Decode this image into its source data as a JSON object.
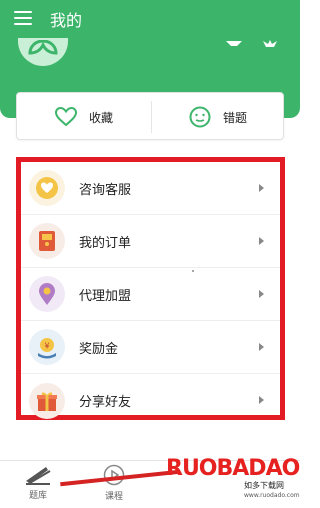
{
  "header": {
    "title": "我的"
  },
  "quick_actions": [
    {
      "label": "收藏",
      "icon": "heart-icon"
    },
    {
      "label": "错题",
      "icon": "smiley-icon"
    }
  ],
  "menu": [
    {
      "label": "咨询客服",
      "icon": "heart-chat-icon"
    },
    {
      "label": "我的订单",
      "icon": "order-envelope-icon"
    },
    {
      "label": "代理加盟",
      "icon": "location-pin-icon"
    },
    {
      "label": "奖励金",
      "icon": "money-bag-icon"
    },
    {
      "label": "分享好友",
      "icon": "gift-box-icon"
    }
  ],
  "bottom_nav": [
    {
      "label": "题库",
      "icon": "question-bank-icon"
    },
    {
      "label": "课程",
      "icon": "play-circle-icon"
    }
  ],
  "watermark": {
    "brand": "RUOBADAO",
    "slogan": "如多下载网",
    "url": "www.ruodado.com"
  },
  "colors": {
    "primary_green": "#3cb56b",
    "highlight_red": "#e21b24"
  }
}
